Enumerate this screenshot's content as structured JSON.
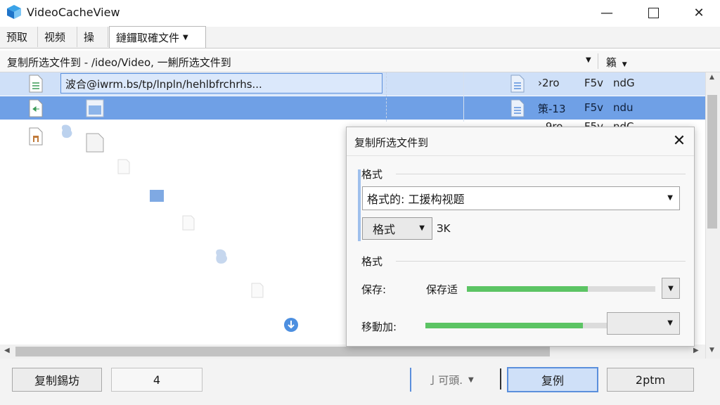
{
  "window": {
    "title": "VideoCacheView"
  },
  "tabs": [
    {
      "label": "预取"
    },
    {
      "label": "视频"
    },
    {
      "label": "操"
    },
    {
      "label": "鏈鑼取確文件"
    }
  ],
  "pathbar": {
    "text": "复制所选文件到 - /ideo/Video, 一鯏所选文件到",
    "right_label": "籟"
  },
  "rows": [
    {
      "name_value": "波合@iwrm.bs/tp/lnpln/hehlbfrchrhs...",
      "col1": "›2ro",
      "col2": "F5v",
      "col3": "ndG"
    },
    {
      "name_value": "",
      "col1": "策-13",
      "col2": "F5v",
      "col3": "ndu"
    },
    {
      "name_value": "",
      "col1": "--9ro",
      "col2": "F5v",
      "col3": "ndC"
    }
  ],
  "bottom": {
    "copy_button": "复制錫坊",
    "count_value": "4",
    "dropdown_label": "亅可頭.",
    "primary_button": "复例",
    "ok_button": "2ptm"
  },
  "dialog": {
    "title": "复制所选文件到",
    "group1_label": "格式",
    "format_combo_value": "格式的: 工援构视题",
    "small_combo_value": "格式",
    "small_combo_suffix": "ЗK",
    "group2_label": "格式",
    "row1_label": "保存:",
    "row1_value": "保存适",
    "row1_progress": 0.64,
    "row2_label": "移動加:",
    "row2_progress": 0.86
  },
  "colors": {
    "selection": "#6fa0e6",
    "selection_light": "#cfe0f8",
    "progress": "#5cc464"
  }
}
